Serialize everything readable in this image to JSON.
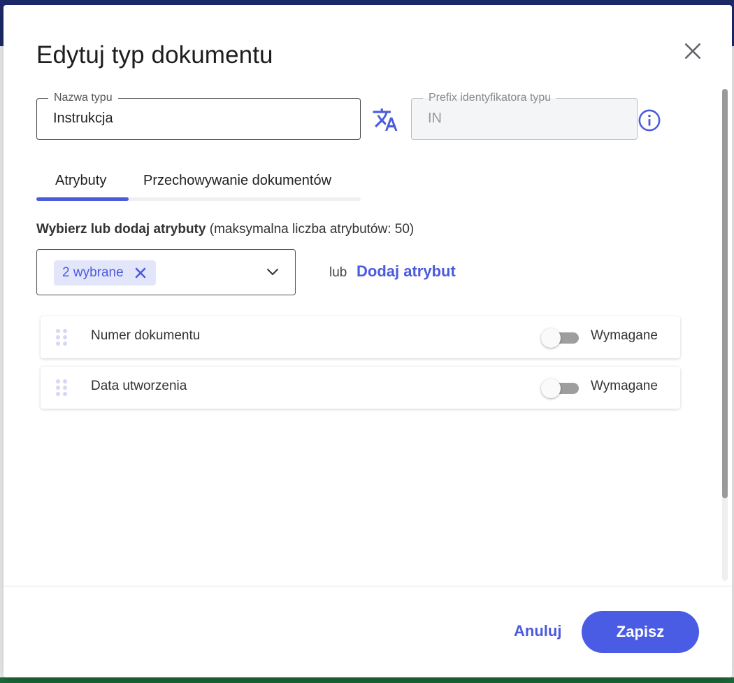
{
  "dialog": {
    "title": "Edytuj typ dokumentu",
    "close_icon": "close-icon"
  },
  "fields": {
    "name": {
      "label": "Nazwa typu",
      "value": "Instrukcja"
    },
    "prefix": {
      "label": "Prefix identyfikatora typu",
      "value": "IN",
      "disabled": true
    }
  },
  "icons": {
    "translate": "translate-icon",
    "info": "info-icon",
    "drag": "drag-handle-icon",
    "chevron": "chevron-down-icon"
  },
  "tabs": [
    {
      "label": "Atrybuty",
      "active": true
    },
    {
      "label": "Przechowywanie dokumentów",
      "active": false
    }
  ],
  "attributes_section": {
    "label_bold": "Wybierz lub dodaj atrybuty",
    "label_rest": " (maksymalna liczba atrybutów: 50)",
    "selected_chip": "2 wybrane",
    "or_text": "lub",
    "add_link": "Dodaj atrybut"
  },
  "attributes": [
    {
      "name": "Numer dokumentu",
      "required_label": "Wymagane",
      "required": false
    },
    {
      "name": "Data utworzenia",
      "required_label": "Wymagane",
      "required": false
    }
  ],
  "footer": {
    "cancel": "Anuluj",
    "save": "Zapisz"
  },
  "colors": {
    "accent": "#4a5bdc",
    "save_button": "#4a5be4",
    "chip_bg": "#e3e6fb"
  }
}
